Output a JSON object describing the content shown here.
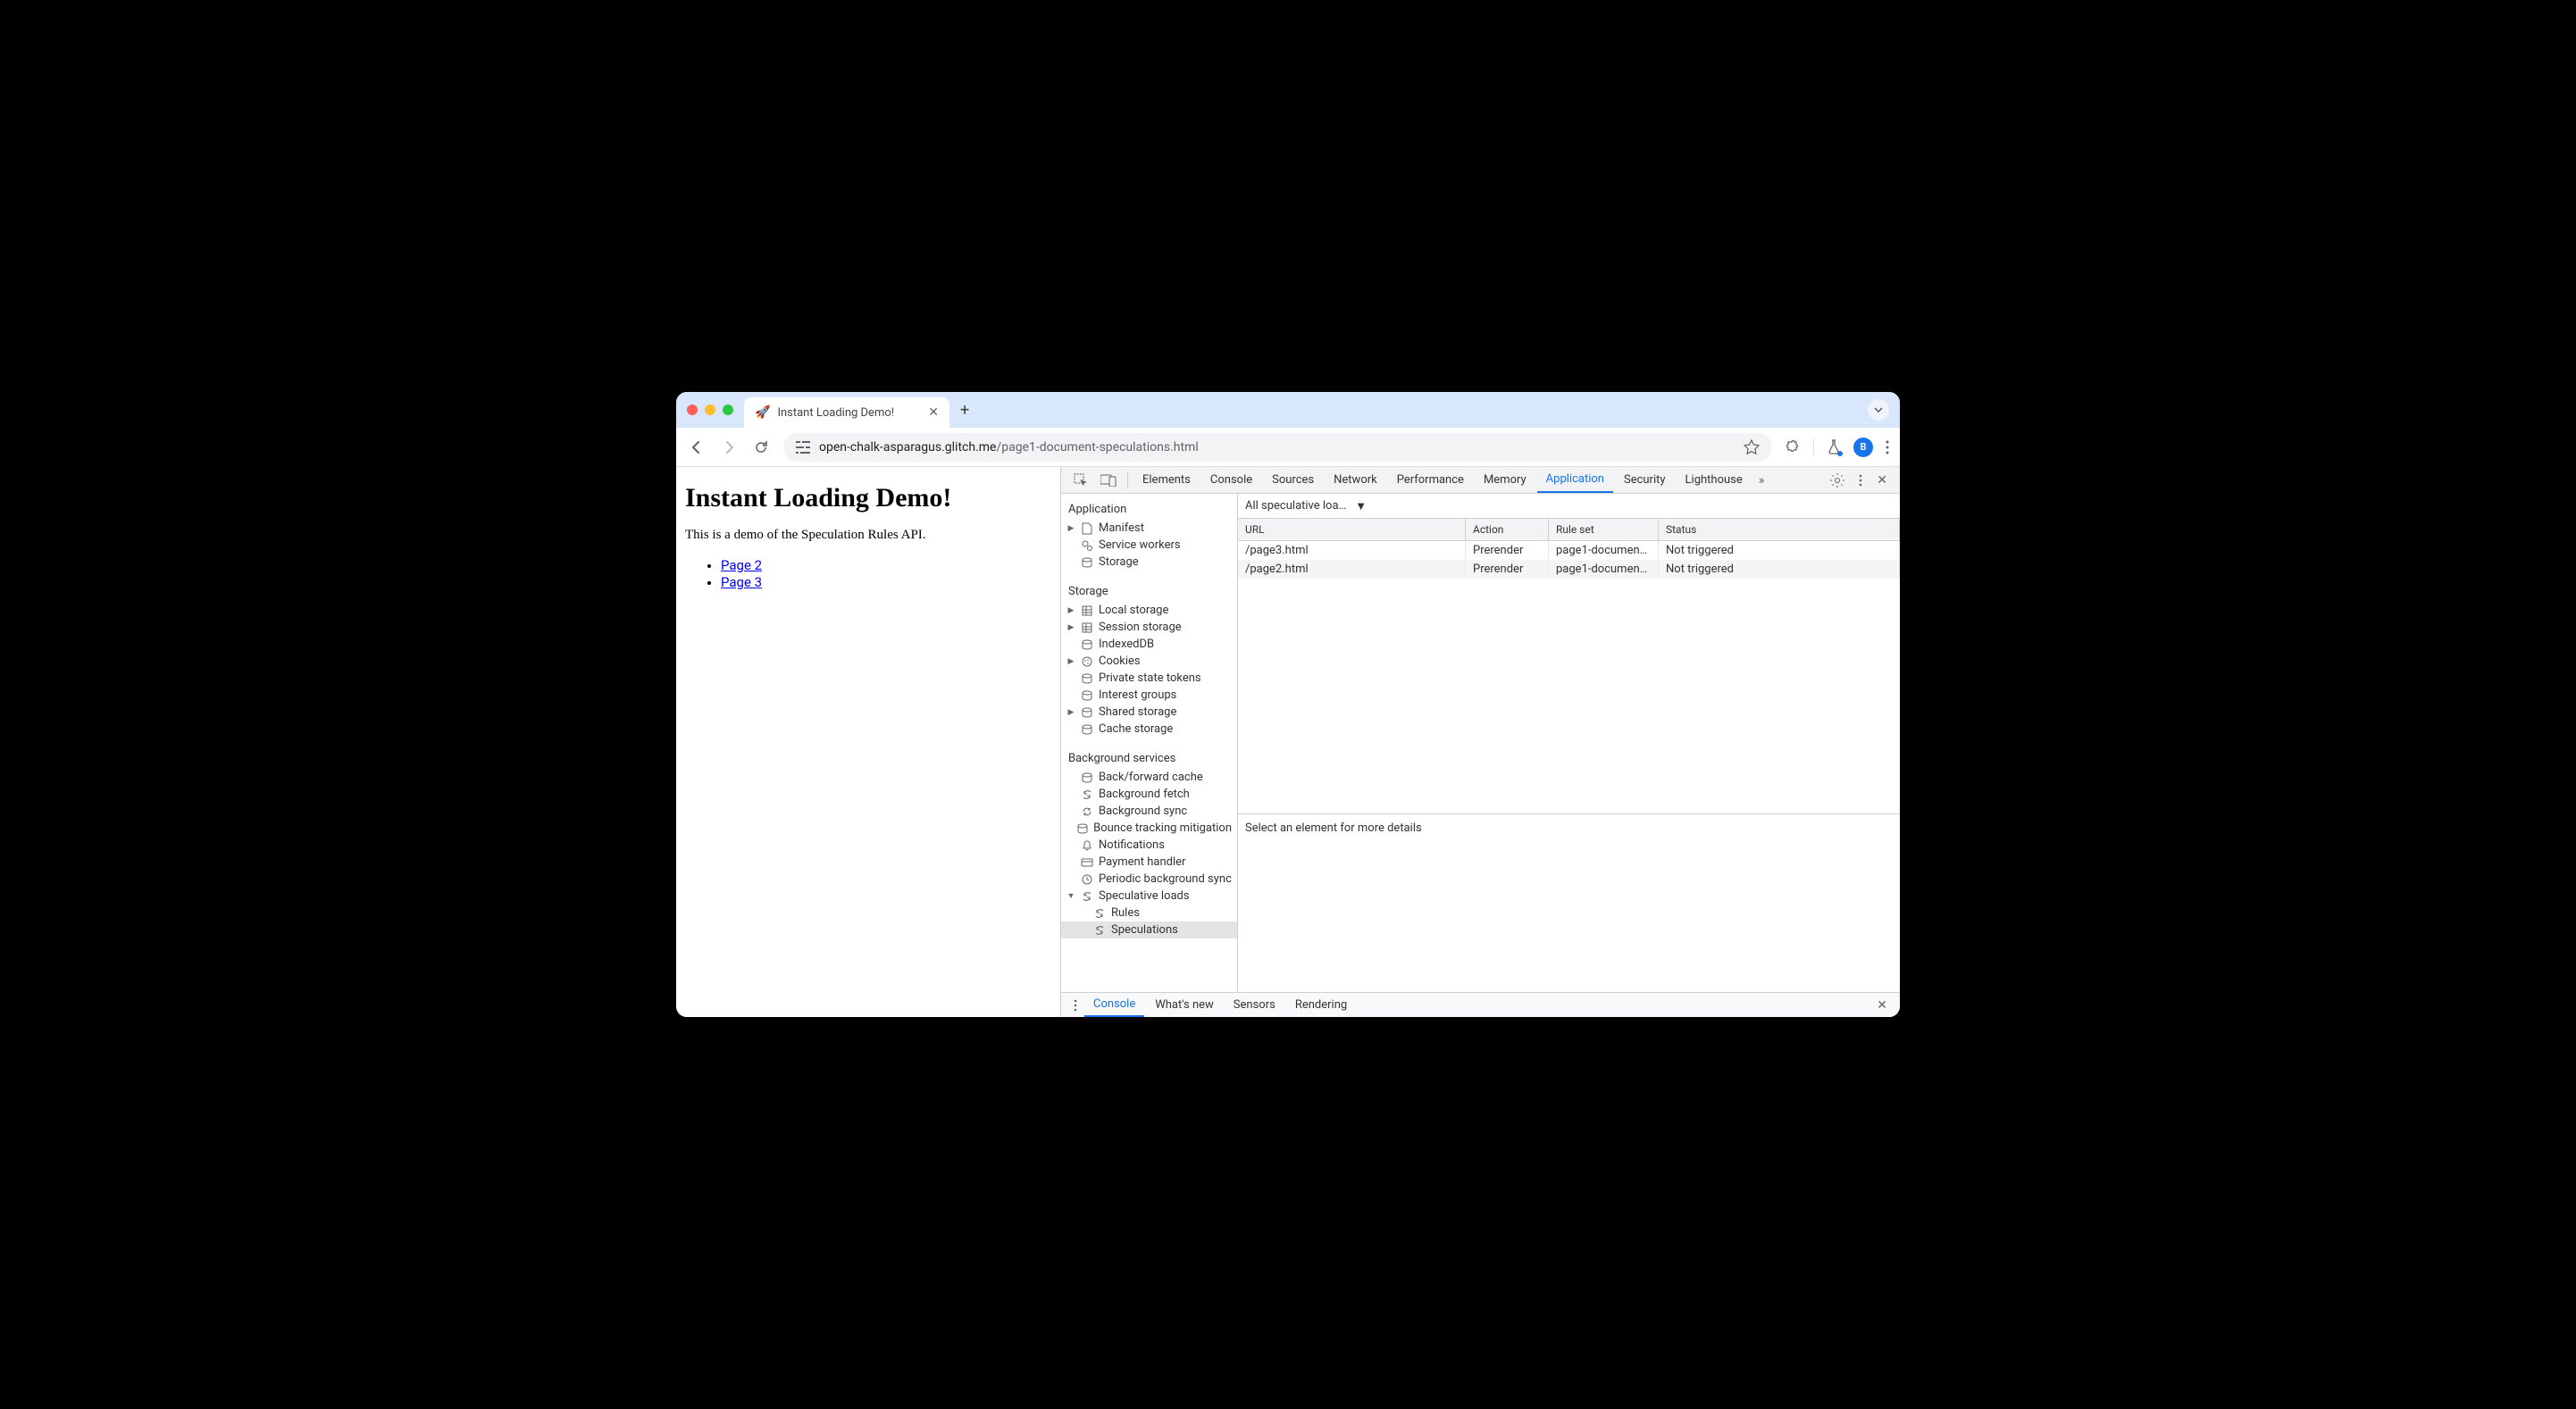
{
  "tab": {
    "title": "Instant Loading Demo!",
    "icon": "🚀"
  },
  "url": {
    "host": "open-chalk-asparagus.glitch.me",
    "path": "/page1-document-speculations.html"
  },
  "avatar": "B",
  "page": {
    "heading": "Instant Loading Demo!",
    "intro": "This is a demo of the Speculation Rules API.",
    "links": [
      "Page 2",
      "Page 3"
    ]
  },
  "devtools": {
    "tabs": [
      "Elements",
      "Console",
      "Sources",
      "Network",
      "Performance",
      "Memory",
      "Application",
      "Security",
      "Lighthouse"
    ],
    "activeTab": "Application",
    "sidebar": {
      "application": {
        "title": "Application",
        "items": [
          "Manifest",
          "Service workers",
          "Storage"
        ]
      },
      "storage": {
        "title": "Storage",
        "items": [
          "Local storage",
          "Session storage",
          "IndexedDB",
          "Cookies",
          "Private state tokens",
          "Interest groups",
          "Shared storage",
          "Cache storage"
        ]
      },
      "background": {
        "title": "Background services",
        "items": [
          "Back/forward cache",
          "Background fetch",
          "Background sync",
          "Bounce tracking mitigation",
          "Notifications",
          "Payment handler",
          "Periodic background sync",
          "Speculative loads"
        ],
        "specChildren": [
          "Rules",
          "Speculations"
        ]
      }
    },
    "dropdown": "All speculative loa…",
    "columns": [
      "URL",
      "Action",
      "Rule set",
      "Status"
    ],
    "rows": [
      {
        "url": "/page3.html",
        "action": "Prerender",
        "ruleset": "page1-document-…",
        "status": "Not triggered"
      },
      {
        "url": "/page2.html",
        "action": "Prerender",
        "ruleset": "page1-document-…",
        "status": "Not triggered"
      }
    ],
    "detail": "Select an element for more details",
    "drawer": [
      "Console",
      "What's new",
      "Sensors",
      "Rendering"
    ]
  }
}
